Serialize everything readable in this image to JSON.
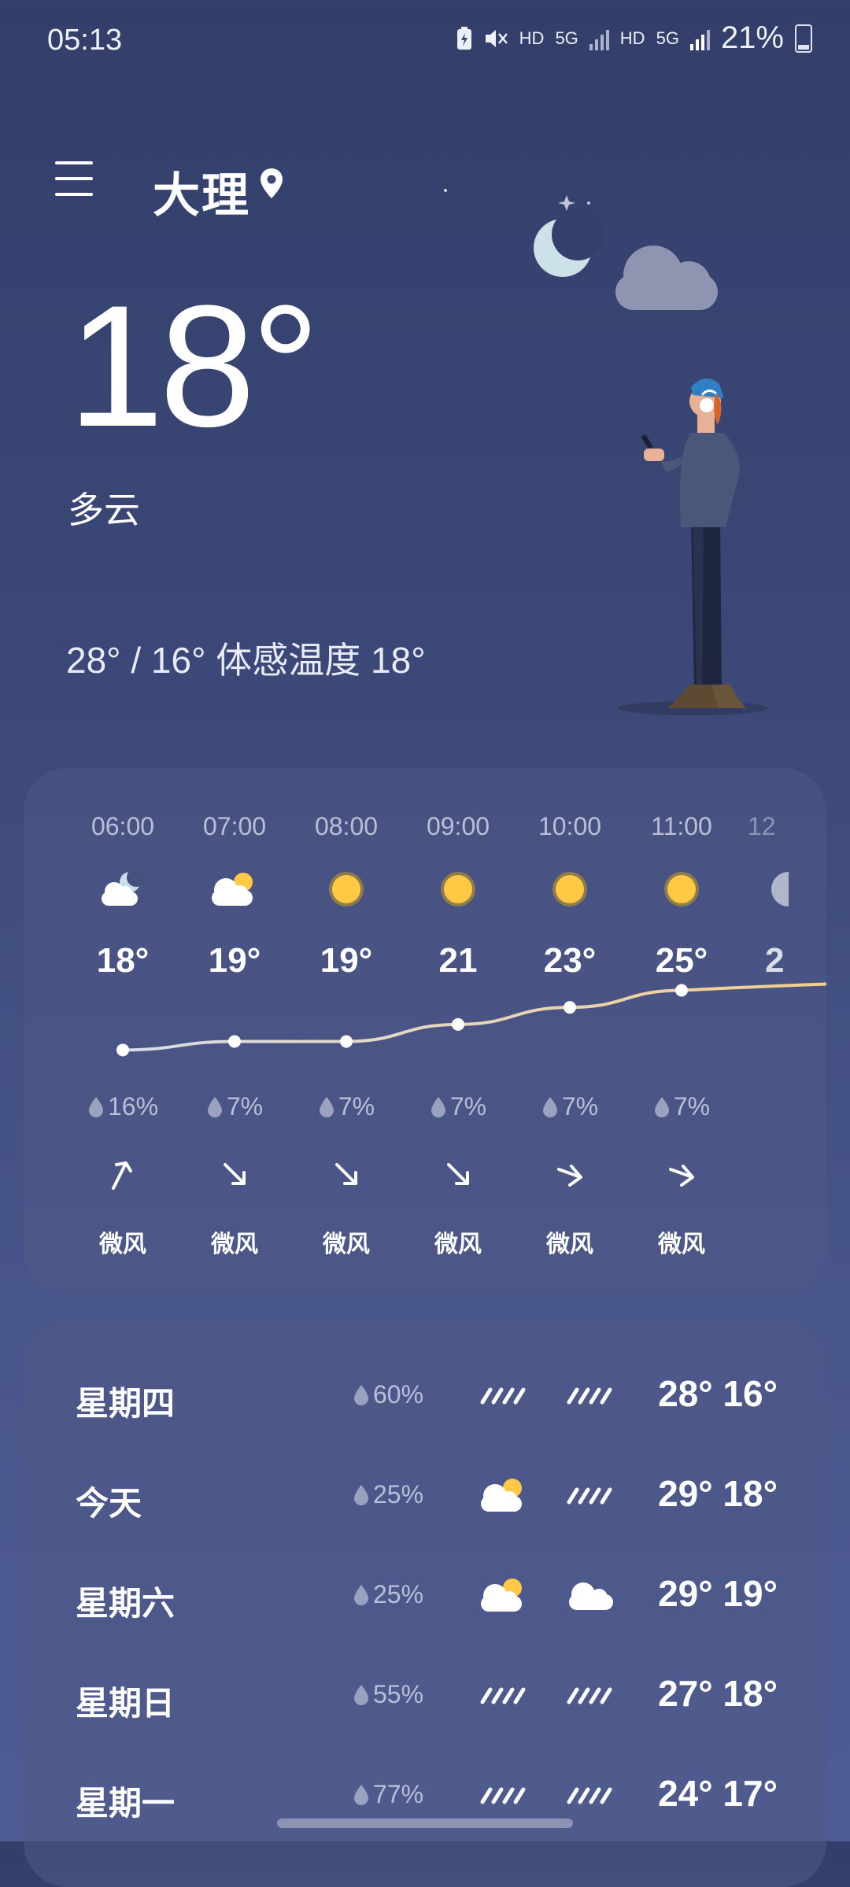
{
  "status_bar": {
    "time": "05:13",
    "net1": "HD",
    "net2": "5G",
    "net3": "HD",
    "net4": "5G",
    "battery": "21%"
  },
  "header": {
    "city": "大理",
    "menu_icon": "hamburger-menu-icon",
    "location_icon": "location-pin-icon"
  },
  "current": {
    "temperature": "18°",
    "condition": "多云",
    "range_feels": "28° / 16° 体感温度 18°"
  },
  "hourly": [
    {
      "time": "06:00",
      "icon": "moon-cloud-icon",
      "temp": "18°",
      "precip": "16%",
      "wind_icon": "arrow-up-right-icon",
      "wind": "微风",
      "temp_value": 18
    },
    {
      "time": "07:00",
      "icon": "sun-cloud-icon",
      "temp": "19°",
      "precip": "7%",
      "wind_icon": "arrow-down-right-icon",
      "wind": "微风",
      "temp_value": 19
    },
    {
      "time": "08:00",
      "icon": "sun-icon",
      "temp": "19°",
      "precip": "7%",
      "wind_icon": "arrow-down-right-icon",
      "wind": "微风",
      "temp_value": 19
    },
    {
      "time": "09:00",
      "icon": "sun-icon",
      "temp": "21",
      "precip": "7%",
      "wind_icon": "arrow-down-right-icon",
      "wind": "微风",
      "temp_value": 21
    },
    {
      "time": "10:00",
      "icon": "sun-icon",
      "temp": "23°",
      "precip": "7%",
      "wind_icon": "arrow-right-icon",
      "wind": "微风",
      "temp_value": 23
    },
    {
      "time": "11:00",
      "icon": "sun-icon",
      "temp": "25°",
      "precip": "7%",
      "wind_icon": "arrow-right-icon",
      "wind": "微风",
      "temp_value": 25
    }
  ],
  "daily": [
    {
      "day": "星期四",
      "precip": "60%",
      "icon_day": "rain-icon",
      "icon_night": "rain-icon",
      "temps": "28° 16°"
    },
    {
      "day": "今天",
      "precip": "25%",
      "icon_day": "sun-cloud-icon",
      "icon_night": "rain-icon",
      "temps": "29° 18°"
    },
    {
      "day": "星期六",
      "precip": "25%",
      "icon_day": "sun-cloud-icon",
      "icon_night": "cloud-icon",
      "temps": "29° 19°"
    },
    {
      "day": "星期日",
      "precip": "55%",
      "icon_day": "rain-icon",
      "icon_night": "rain-icon",
      "temps": "27° 18°"
    },
    {
      "day": "星期一",
      "precip": "77%",
      "icon_day": "rain-icon",
      "icon_night": "rain-icon",
      "temps": "24° 17°"
    }
  ],
  "colors": {
    "sun": "#ffc845",
    "moon": "#c8dfe6",
    "line_start": "#d8dcea",
    "line_end": "#f4cf8a"
  }
}
